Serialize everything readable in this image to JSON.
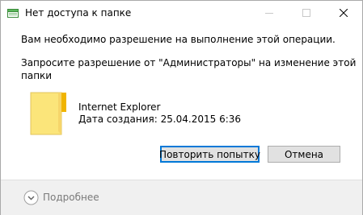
{
  "window": {
    "title": "Нет доступа к папке",
    "controls": {
      "minimize_icon": "minimize-icon",
      "maximize_icon": "maximize-icon",
      "close_icon": "close-icon"
    }
  },
  "message": {
    "line1": "Вам необходимо разрешение на выполнение этой операции.",
    "line2": "Запросите разрешение от \"Администраторы\" на изменение этой",
    "line3": "папки"
  },
  "item": {
    "icon": "folder-icon",
    "name": "Internet Explorer",
    "created": "Дата создания: 25.04.2015 6:36"
  },
  "buttons": {
    "retry_label": "Повторить попытку",
    "cancel_label": "Отмена"
  },
  "footer": {
    "expander_icon": "chevron-down-icon",
    "details_label": "Подробнее"
  },
  "colors": {
    "folder_body": "#fbe57a",
    "folder_tab": "#f0b400",
    "accent_border": "#0078d7",
    "footer_bg": "#f0f0f0"
  }
}
